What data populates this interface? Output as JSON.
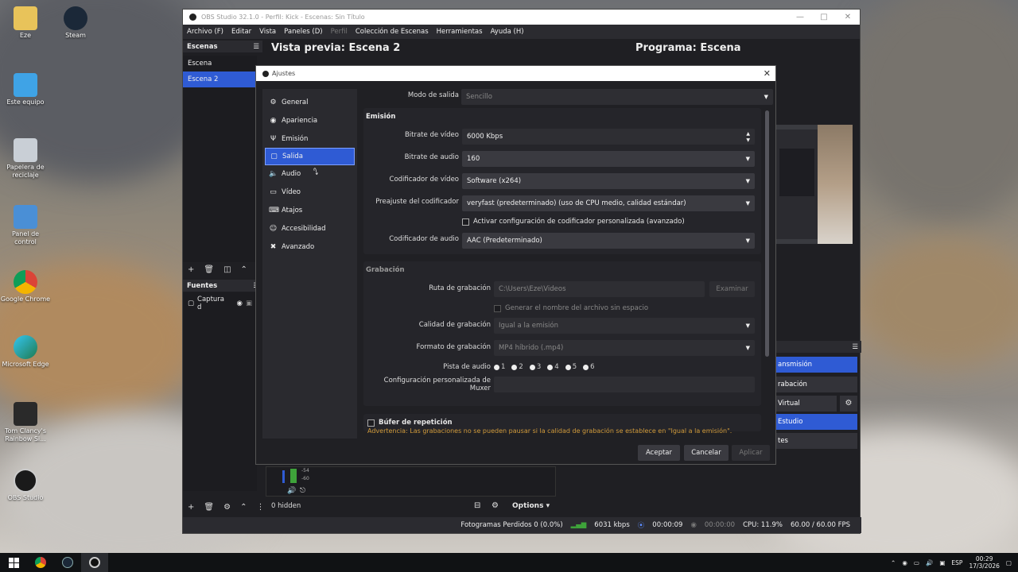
{
  "desktop": {
    "icons": [
      {
        "label": "Eze"
      },
      {
        "label": "Steam"
      },
      {
        "label": "Este equipo"
      },
      {
        "label": "Papelera de reciclaje"
      },
      {
        "label": "Panel de control"
      },
      {
        "label": "Google Chrome"
      },
      {
        "label": "Microsoft Edge"
      },
      {
        "label": "Tom Clancy's Rainbow Si..."
      },
      {
        "label": "OBS Studio"
      }
    ]
  },
  "obs": {
    "title": "OBS Studio 32.1.0 - Perfil: Kick - Escenas: Sin Título",
    "menu": [
      "Archivo (F)",
      "Editar",
      "Vista",
      "Paneles (D)",
      "Perfil",
      "Colección de Escenas",
      "Herramientas",
      "Ayuda (H)"
    ],
    "scenes_header": "Escenas",
    "scenes": [
      "Escena",
      "Escena 2"
    ],
    "preview_title": "Vista previa: Escena 2",
    "program_title": "Programa: Escena",
    "sources_header": "Fuentes",
    "source_item": "Captura d",
    "hidden_label": "0 hidden",
    "options_label": "Options",
    "controls": {
      "stream": "ansmisión",
      "record": "rabación",
      "virtual": "Virtual",
      "studio": "Estudio",
      "settings": "tes"
    },
    "mixer": {
      "db1": "-54",
      "db2": "-60"
    },
    "status": {
      "dropped": "Fotogramas Perdidos 0 (0.0%)",
      "bitrate": "6031 kbps",
      "stream_time": "00:00:09",
      "rec_time": "00:00:00",
      "cpu": "CPU: 11.9%",
      "fps": "60.00 / 60.00 FPS"
    }
  },
  "settings": {
    "title": "Ajustes",
    "sidebar": [
      {
        "label": "General",
        "icon": "gear-icon"
      },
      {
        "label": "Apariencia",
        "icon": "palette-icon"
      },
      {
        "label": "Emisión",
        "icon": "antenna-icon"
      },
      {
        "label": "Salida",
        "icon": "output-icon"
      },
      {
        "label": "Audio",
        "icon": "speaker-icon"
      },
      {
        "label": "Vídeo",
        "icon": "monitor-icon"
      },
      {
        "label": "Atajos",
        "icon": "keyboard-icon"
      },
      {
        "label": "Accesibilidad",
        "icon": "accessibility-icon"
      },
      {
        "label": "Avanzado",
        "icon": "wrench-icon"
      }
    ],
    "selected": "Salida",
    "output_mode_label": "Modo de salida",
    "output_mode_value": "Sencillo",
    "streaming": {
      "header": "Emisión",
      "video_bitrate_label": "Bitrate de vídeo",
      "video_bitrate_value": "6000 Kbps",
      "audio_bitrate_label": "Bitrate de audio",
      "audio_bitrate_value": "160",
      "video_encoder_label": "Codificador de vídeo",
      "video_encoder_value": "Software (x264)",
      "preset_label": "Preajuste del codificador",
      "preset_value": "veryfast (predeterminado) (uso de CPU medio, calidad estándar)",
      "custom_label": "Activar configuración de codificador personalizada (avanzado)",
      "audio_encoder_label": "Codificador de audio",
      "audio_encoder_value": "AAC (Predeterminado)"
    },
    "recording": {
      "header": "Grabación",
      "path_label": "Ruta de grabación",
      "path_value": "C:\\Users\\Eze\\Videos",
      "browse": "Examinar",
      "nospace_label": "Generar el nombre del archivo sin espacio",
      "quality_label": "Calidad de grabación",
      "quality_value": "Igual a la emisión",
      "format_label": "Formato de grabación",
      "format_value": "MP4 híbrido (.mp4)",
      "track_label": "Pista de audio",
      "tracks": [
        "1",
        "2",
        "3",
        "4",
        "5",
        "6"
      ],
      "muxer_label": "Configuración personalizada de Muxer"
    },
    "replay_label": "Búfer de repetición",
    "warning": "Advertencia: Las grabaciones no se pueden pausar si la calidad de grabación se establece en \"Igual a la emisión\".",
    "buttons": {
      "ok": "Aceptar",
      "cancel": "Cancelar",
      "apply": "Aplicar"
    }
  },
  "taskbar": {
    "lang": "ESP",
    "time": "00:29",
    "date": "17/3/2026"
  }
}
